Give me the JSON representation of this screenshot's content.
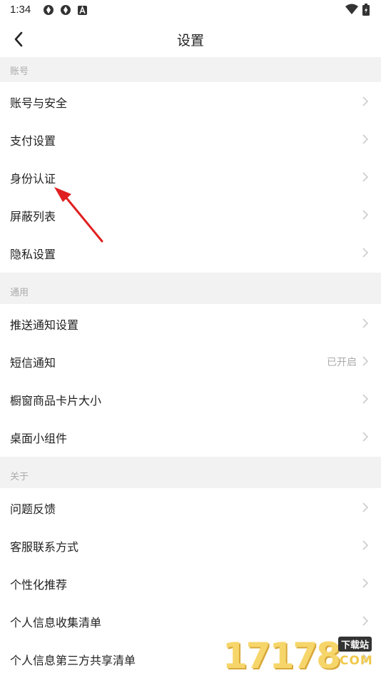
{
  "status_bar": {
    "time": "1:34"
  },
  "header": {
    "title": "设置"
  },
  "sections": [
    {
      "title": "账号",
      "items": [
        {
          "label": "账号与安全"
        },
        {
          "label": "支付设置"
        },
        {
          "label": "身份认证"
        },
        {
          "label": "屏蔽列表"
        },
        {
          "label": "隐私设置"
        }
      ]
    },
    {
      "title": "通用",
      "items": [
        {
          "label": "推送通知设置"
        },
        {
          "label": "短信通知",
          "value": "已开启"
        },
        {
          "label": "橱窗商品卡片大小"
        },
        {
          "label": "桌面小组件"
        }
      ]
    },
    {
      "title": "关于",
      "items": [
        {
          "label": "问题反馈"
        },
        {
          "label": "客服联系方式"
        },
        {
          "label": "个性化推荐"
        },
        {
          "label": "个人信息收集清单"
        },
        {
          "label": "个人信息第三方共享清单"
        }
      ]
    }
  ],
  "watermark": {
    "digits": "17178",
    "tag": "下载站",
    "domain": "COM"
  },
  "colors": {
    "section_bg": "#f2f2f2",
    "chevron": "#cccccc",
    "annotation_arrow": "#e02020",
    "watermark": "#f6d66a"
  }
}
